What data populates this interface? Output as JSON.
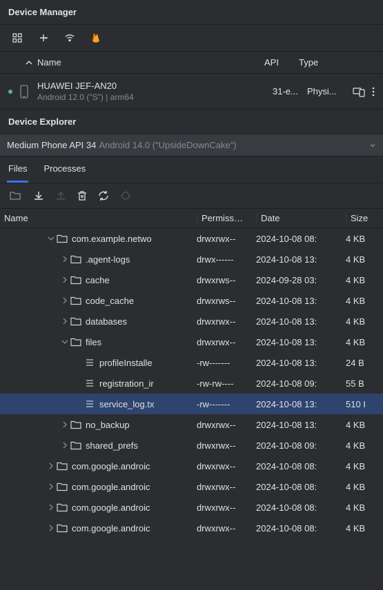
{
  "device_manager": {
    "title": "Device Manager",
    "columns": {
      "name": "Name",
      "api": "API",
      "type": "Type"
    },
    "device": {
      "name": "HUAWEI JEF-AN20",
      "subtitle": "Android 12.0 (\"S\") | arm64",
      "api": "31-e...",
      "type": "Physi..."
    }
  },
  "device_explorer": {
    "title": "Device Explorer",
    "selected_device": "Medium Phone API 34",
    "selected_device_sub": "Android 14.0 (\"UpsideDownCake\")",
    "tabs": {
      "files": "Files",
      "processes": "Processes"
    },
    "columns": {
      "name": "Name",
      "permissions": "Permiss…",
      "date": "Date",
      "size": "Size"
    }
  },
  "tree": [
    {
      "indent": 3,
      "expand": "down",
      "kind": "folder",
      "name": "com.example.netwo",
      "perms": "drwxrwx--",
      "date": "2024-10-08 08:",
      "size": "4 KB",
      "selected": false
    },
    {
      "indent": 4,
      "expand": "right",
      "kind": "folder",
      "name": ".agent-logs",
      "perms": "drwx------",
      "date": "2024-10-08 13:",
      "size": "4 KB",
      "selected": false
    },
    {
      "indent": 4,
      "expand": "right",
      "kind": "folder",
      "name": "cache",
      "perms": "drwxrws--",
      "date": "2024-09-28 03:",
      "size": "4 KB",
      "selected": false
    },
    {
      "indent": 4,
      "expand": "right",
      "kind": "folder",
      "name": "code_cache",
      "perms": "drwxrws--",
      "date": "2024-10-08 13:",
      "size": "4 KB",
      "selected": false
    },
    {
      "indent": 4,
      "expand": "right",
      "kind": "folder",
      "name": "databases",
      "perms": "drwxrwx--",
      "date": "2024-10-08 13:",
      "size": "4 KB",
      "selected": false
    },
    {
      "indent": 4,
      "expand": "down",
      "kind": "folder",
      "name": "files",
      "perms": "drwxrwx--",
      "date": "2024-10-08 13:",
      "size": "4 KB",
      "selected": false
    },
    {
      "indent": 5,
      "expand": "none",
      "kind": "file",
      "name": "profileInstalle",
      "perms": "-rw-------",
      "date": "2024-10-08 13:",
      "size": "24 B",
      "selected": false
    },
    {
      "indent": 5,
      "expand": "none",
      "kind": "file",
      "name": "registration_ir",
      "perms": "-rw-rw----",
      "date": "2024-10-08 09:",
      "size": "55 B",
      "selected": false
    },
    {
      "indent": 5,
      "expand": "none",
      "kind": "file",
      "name": "service_log.tx",
      "perms": "-rw-------",
      "date": "2024-10-08 13:",
      "size": "510 I",
      "selected": true
    },
    {
      "indent": 4,
      "expand": "right",
      "kind": "folder",
      "name": "no_backup",
      "perms": "drwxrwx--",
      "date": "2024-10-08 13:",
      "size": "4 KB",
      "selected": false
    },
    {
      "indent": 4,
      "expand": "right",
      "kind": "folder",
      "name": "shared_prefs",
      "perms": "drwxrwx--",
      "date": "2024-10-08 09:",
      "size": "4 KB",
      "selected": false
    },
    {
      "indent": 3,
      "expand": "right",
      "kind": "folder",
      "name": "com.google.androic",
      "perms": "drwxrwx--",
      "date": "2024-10-08 08:",
      "size": "4 KB",
      "selected": false
    },
    {
      "indent": 3,
      "expand": "right",
      "kind": "folder",
      "name": "com.google.androic",
      "perms": "drwxrwx--",
      "date": "2024-10-08 08:",
      "size": "4 KB",
      "selected": false
    },
    {
      "indent": 3,
      "expand": "right",
      "kind": "folder",
      "name": "com.google.androic",
      "perms": "drwxrwx--",
      "date": "2024-10-08 08:",
      "size": "4 KB",
      "selected": false
    },
    {
      "indent": 3,
      "expand": "right",
      "kind": "folder",
      "name": "com.google.androic",
      "perms": "drwxrwx--",
      "date": "2024-10-08 08:",
      "size": "4 KB",
      "selected": false
    }
  ]
}
